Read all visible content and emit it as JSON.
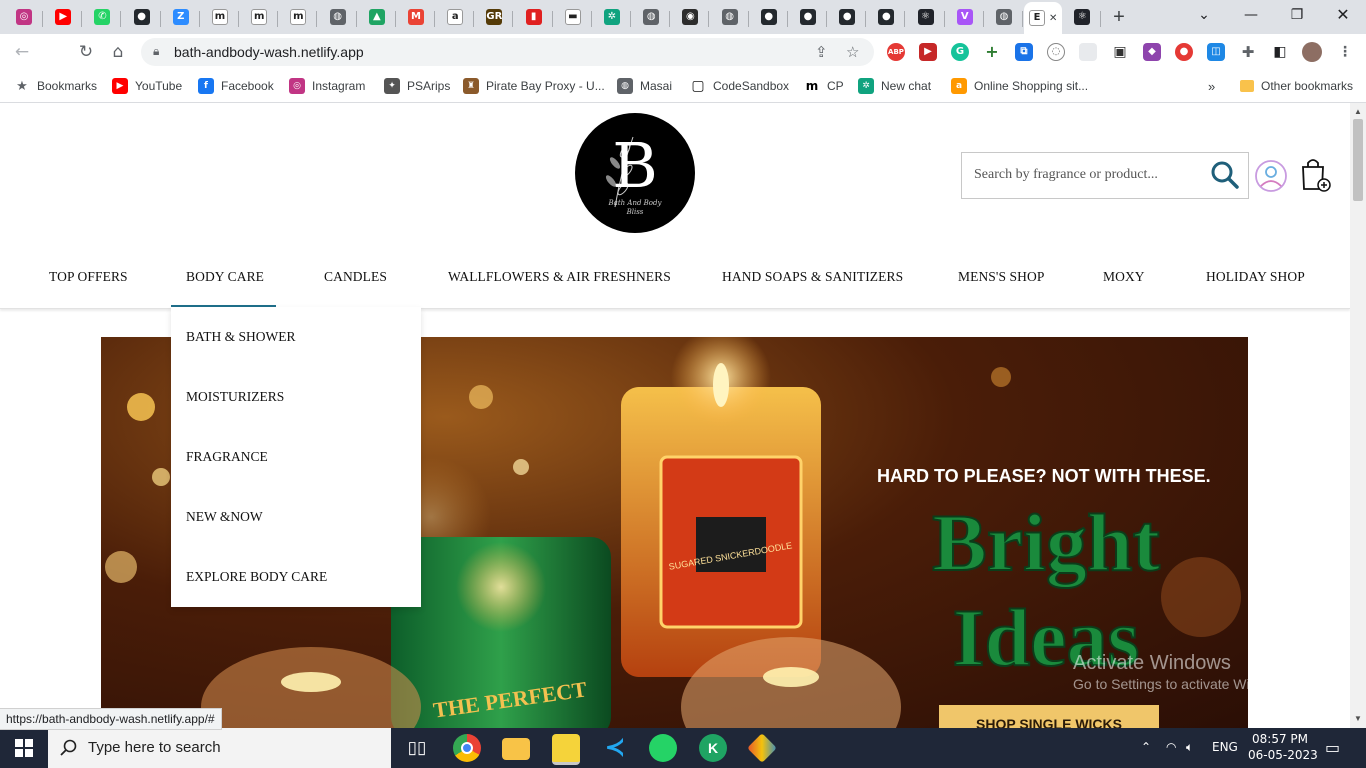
{
  "browser": {
    "tabs": [
      {
        "icon": "instagram-icon",
        "color": "#c13584",
        "glyph": "◎"
      },
      {
        "icon": "youtube-icon",
        "color": "#ff0000",
        "glyph": "▶"
      },
      {
        "icon": "whatsapp-icon",
        "color": "#25d366",
        "glyph": "✆"
      },
      {
        "icon": "github-icon",
        "color": "#24292e",
        "glyph": "●"
      },
      {
        "icon": "zoom-icon",
        "color": "#2d8cff",
        "glyph": "Z"
      },
      {
        "icon": "masai-icon",
        "color": "#fff",
        "glyph": "m"
      },
      {
        "icon": "masai-icon",
        "color": "#fff",
        "glyph": "m"
      },
      {
        "icon": "masai-icon",
        "color": "#fff",
        "glyph": "m"
      },
      {
        "icon": "globe-icon",
        "color": "#5f6368",
        "glyph": "◍"
      },
      {
        "icon": "google-drive-icon",
        "color": "#1fa463",
        "glyph": "▲"
      },
      {
        "icon": "gmail-icon",
        "color": "#ea4335",
        "glyph": "M"
      },
      {
        "icon": "amazon-icon",
        "color": "#fff",
        "glyph": "a"
      },
      {
        "icon": "goodreads-icon",
        "color": "#553b08",
        "glyph": "GR"
      },
      {
        "icon": "codeforces-icon",
        "color": "#e02020",
        "glyph": "▮"
      },
      {
        "icon": "ajio-icon",
        "color": "#fff",
        "glyph": "▬"
      },
      {
        "icon": "openai-icon",
        "color": "#10a37f",
        "glyph": "✲"
      },
      {
        "icon": "globe-icon",
        "color": "#5f6368",
        "glyph": "◍"
      },
      {
        "icon": "hackerrank-icon",
        "color": "#2c2c2c",
        "glyph": "◉"
      },
      {
        "icon": "globe-icon",
        "color": "#5f6368",
        "glyph": "◍"
      },
      {
        "icon": "github-icon",
        "color": "#24292e",
        "glyph": "●"
      },
      {
        "icon": "github-icon",
        "color": "#24292e",
        "glyph": "●"
      },
      {
        "icon": "github-icon",
        "color": "#24292e",
        "glyph": "●"
      },
      {
        "icon": "github-icon",
        "color": "#24292e",
        "glyph": "●"
      },
      {
        "icon": "react-icon",
        "color": "#20232a",
        "glyph": "⚛"
      },
      {
        "icon": "vite-icon",
        "color": "#a855f7",
        "glyph": "V"
      },
      {
        "icon": "globe-icon",
        "color": "#5f6368",
        "glyph": "◍"
      },
      {
        "icon": "active-tab-icon",
        "color": "#fff",
        "glyph": "E",
        "active": true
      },
      {
        "icon": "react-icon",
        "color": "#20232a",
        "glyph": "⚛"
      }
    ],
    "url": "bath-andbody-wash.netlify.app",
    "status_url": "https://bath-andbody-wash.netlify.app/#",
    "bookmarks": [
      {
        "label": "Bookmarks",
        "icon": "star-icon",
        "color": "#5f6368"
      },
      {
        "label": "YouTube",
        "icon": "youtube-icon",
        "color": "#ff0000"
      },
      {
        "label": "Facebook",
        "icon": "facebook-icon",
        "color": "#1877f2"
      },
      {
        "label": "Instagram",
        "icon": "instagram-icon",
        "color": "#c13584"
      },
      {
        "label": "PSArips",
        "icon": "psarips-icon",
        "color": "#555"
      },
      {
        "label": "Pirate Bay Proxy - U...",
        "icon": "pirate-icon",
        "color": "#8b5a2b"
      },
      {
        "label": "Masai",
        "icon": "globe-icon",
        "color": "#5f6368"
      },
      {
        "label": "CodeSandbox",
        "icon": "codesandbox-icon",
        "color": "#151515"
      },
      {
        "label": "CP",
        "icon": "masai-icon",
        "color": "#000"
      },
      {
        "label": "New chat",
        "icon": "openai-icon",
        "color": "#10a37f"
      },
      {
        "label": "Online Shopping sit...",
        "icon": "amazon-icon",
        "color": "#ff9900"
      }
    ],
    "other_bookmarks": "Other bookmarks"
  },
  "site": {
    "logo_letter": "B",
    "logo_tagline": "Bath And Body Bliss",
    "search_placeholder": "Search by fragrance or product...",
    "nav": [
      "TOP OFFERS",
      "BODY CARE",
      "CANDLES",
      "WALLFLOWERS & AIR FRESHNERS",
      "HAND SOAPS & SANITIZERS",
      "MENS'S SHOP",
      "MOXY",
      "HOLIDAY SHOP"
    ],
    "dropdown": [
      "BATH & SHOWER",
      "MOISTURIZERS",
      "FRAGRANCE",
      "NEW &NOW",
      "EXPLORE BODY CARE"
    ],
    "banner": {
      "kicker": "HARD TO PLEASE? NOT WITH THESE.",
      "headline_1": "Bright",
      "headline_2": "Ideas",
      "cta": "SHOP SINGLE WICKS",
      "jar_label": "SUGARED SNICKERDOODLE",
      "jar_label_2": "THE PERFECT"
    }
  },
  "os": {
    "watermark_title": "Activate Windows",
    "watermark_sub": "Go to Settings to activate Windows.",
    "search_text": "Type here to search",
    "lang": "ENG",
    "time": "08:57 PM",
    "date": "06-05-2023"
  }
}
